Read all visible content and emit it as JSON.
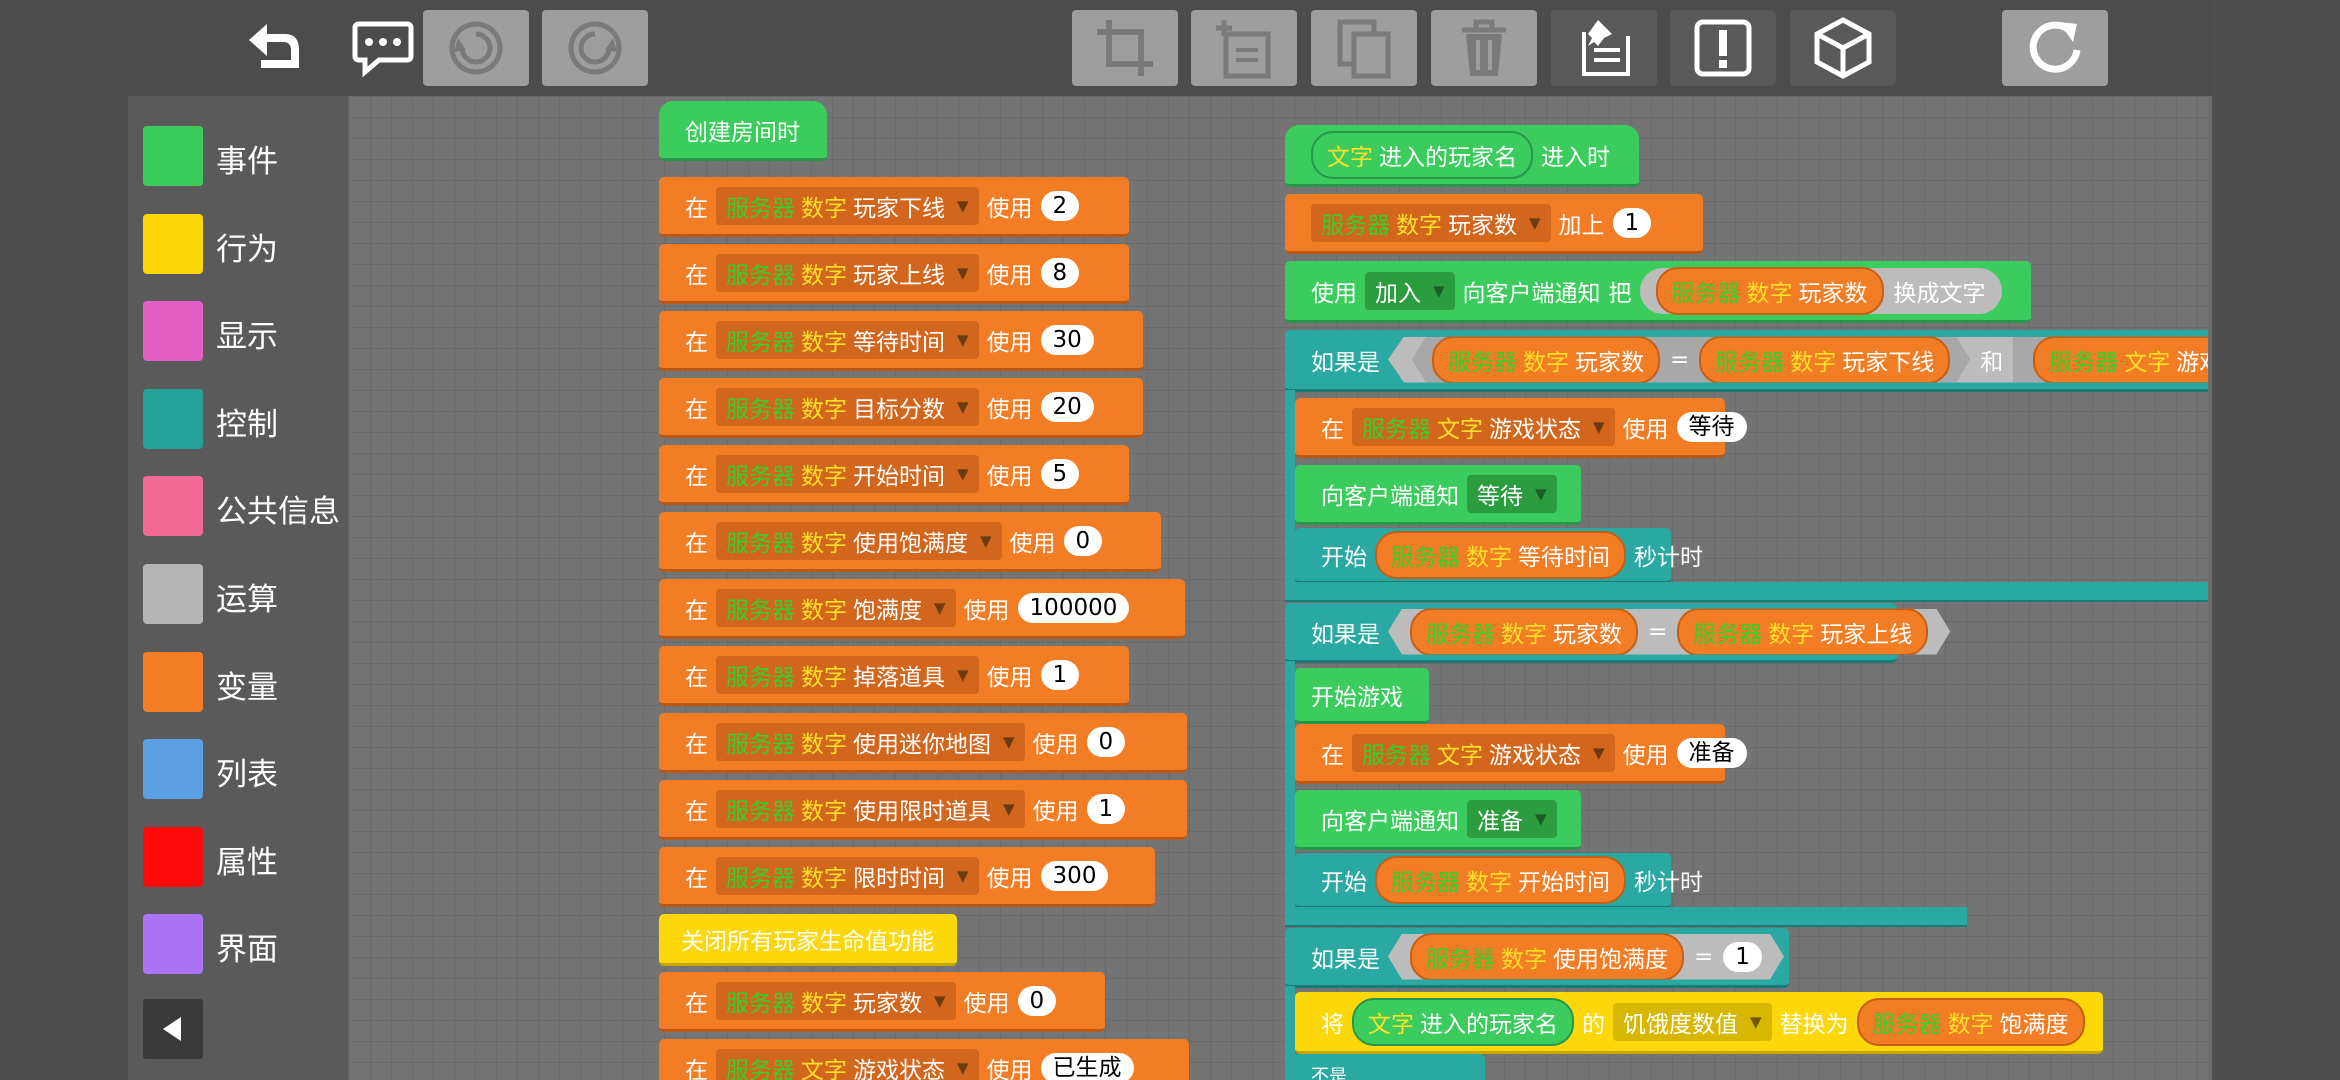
{
  "toolbar": {
    "buttons": [
      {
        "name": "undo-arrow-icon"
      },
      {
        "name": "comment-icon"
      },
      {
        "name": "undo-icon"
      },
      {
        "name": "redo-icon"
      },
      {
        "name": "crop-icon"
      },
      {
        "name": "add-file-icon"
      },
      {
        "name": "copy-icon"
      },
      {
        "name": "trash-icon"
      },
      {
        "name": "pin-list-icon"
      },
      {
        "name": "alert-icon"
      },
      {
        "name": "cube-icon"
      },
      {
        "name": "refresh-icon"
      }
    ]
  },
  "palette": {
    "categories": [
      {
        "label": "事件",
        "color": "#3ccc5e"
      },
      {
        "label": "行为",
        "color": "#fcd80b"
      },
      {
        "label": "显示",
        "color": "#e35fc6"
      },
      {
        "label": "控制",
        "color": "#24a099"
      },
      {
        "label": "公共信息",
        "color": "#f06a95"
      },
      {
        "label": "运算",
        "color": "#b5b5b5"
      },
      {
        "label": "变量",
        "color": "#f27d25"
      },
      {
        "label": "列表",
        "color": "#5aa0e2"
      },
      {
        "label": "属性",
        "color": "#ff0a0a"
      },
      {
        "label": "界面",
        "color": "#ab72f5"
      }
    ],
    "collapse_icon": "triangle-left-icon"
  },
  "common": {
    "at": "在",
    "server": "服务器",
    "number": "数字",
    "text": "文字",
    "use": "使用",
    "start": "开始",
    "seconds_timer": "秒计时",
    "if_is": "如果是",
    "equals": "=",
    "and": "和",
    "notify_client": "向客户端通知"
  },
  "left_script": {
    "event_label": "创建房间时",
    "settings": [
      {
        "var": "玩家下线",
        "value": "2"
      },
      {
        "var": "玩家上线",
        "value": "8"
      },
      {
        "var": "等待时间",
        "value": "30"
      },
      {
        "var": "目标分数",
        "value": "20"
      },
      {
        "var": "开始时间",
        "value": "5"
      },
      {
        "var": "使用饱满度",
        "value": "0"
      },
      {
        "var": "饱满度",
        "value": "100000"
      },
      {
        "var": "掉落道具",
        "value": "1"
      },
      {
        "var": "使用迷你地图",
        "value": "0"
      },
      {
        "var": "使用限时道具",
        "value": "1"
      },
      {
        "var": "限时时间",
        "value": "300"
      }
    ],
    "close_health": "关闭所有玩家生命值功能",
    "after": [
      {
        "var": "玩家数",
        "value": "0",
        "type": "数字"
      }
    ],
    "partial_row": {
      "var": "游戏状态",
      "value": "已生成",
      "type": "文字"
    }
  },
  "right_script": {
    "event_reporter": "进入的玩家名",
    "event_suffix": "进入时",
    "player_count_var": "玩家数",
    "add_label": "加上",
    "add_value": "1",
    "notify_dropdown": "加入",
    "ba": "把",
    "to_text": "换成文字",
    "cond1_right": "玩家下线",
    "cond1_text_var": "游戏状",
    "game_state": "游戏状态",
    "wait_value": "等待",
    "wait_time_var": "等待时间",
    "cond2_right": "玩家上线",
    "start_game": "开始游戏",
    "ready_value": "准备",
    "start_time_var": "开始时间",
    "cond3_var": "使用饱满度",
    "cond3_value": "1",
    "set_label": "将",
    "of_label": "的",
    "hunger_attr": "饥饿度数值",
    "replace_with": "替换为",
    "fullness_var": "饱满度",
    "else_label": "不是"
  }
}
